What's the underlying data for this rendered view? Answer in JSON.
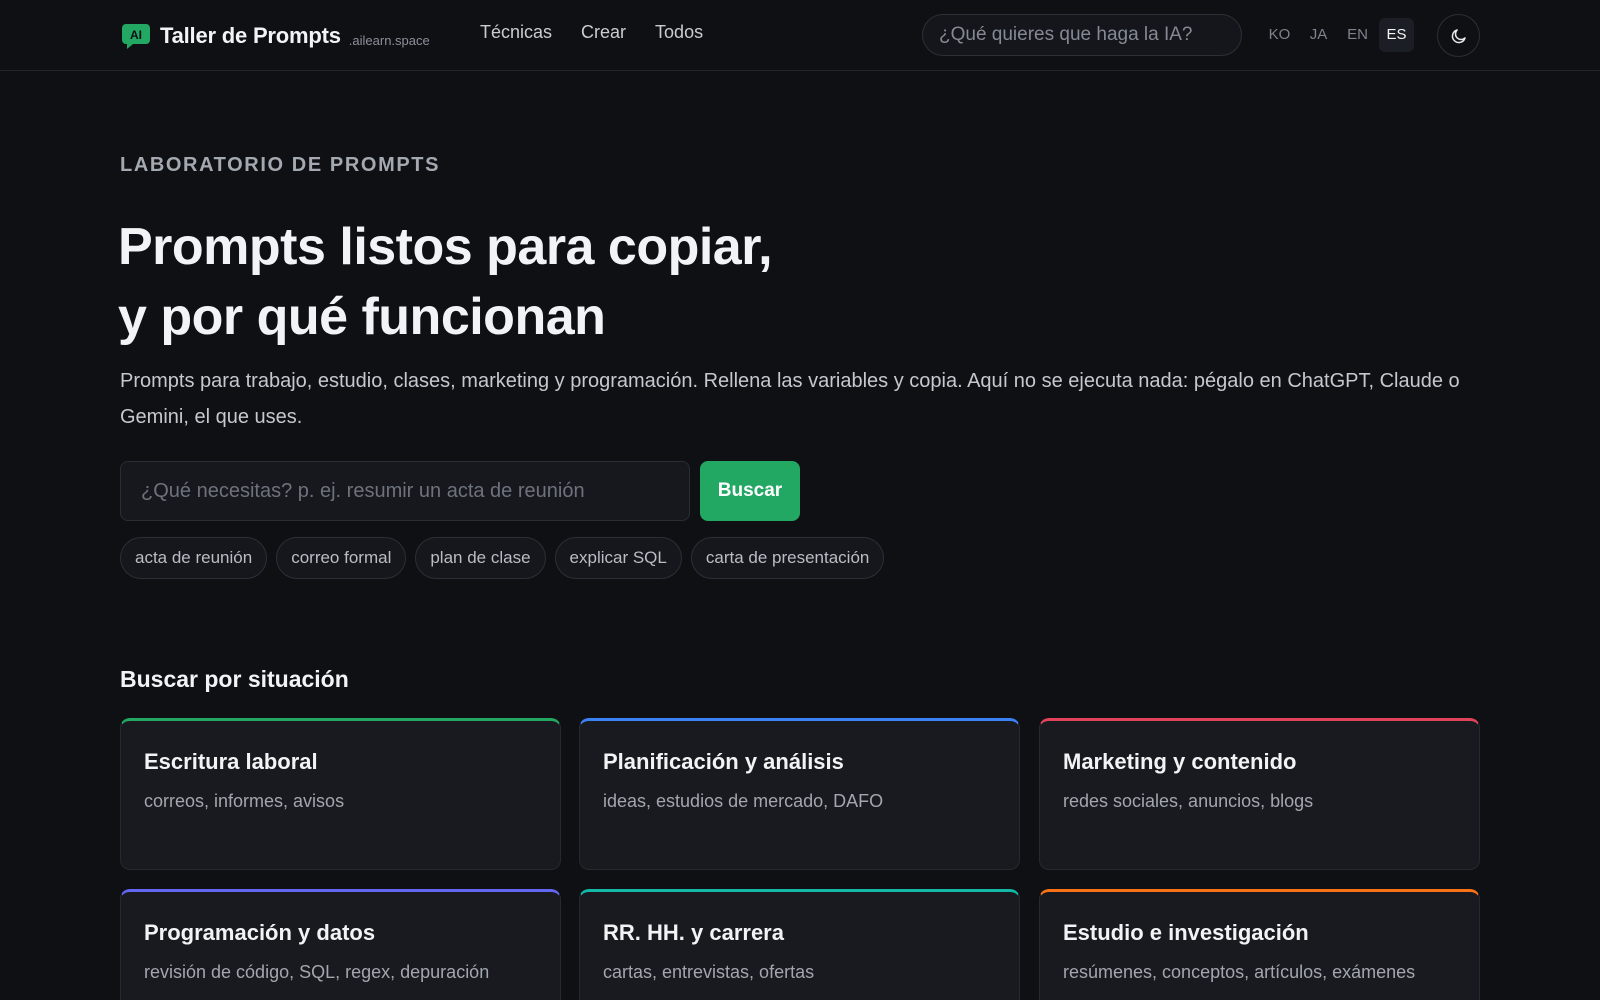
{
  "header": {
    "brand_name": "Taller de Prompts",
    "brand_domain": ".ailearn.space",
    "logo_text": "AI",
    "nav": [
      "Técnicas",
      "Crear",
      "Todos"
    ],
    "search_placeholder": "¿Qué quieres que haga la IA?",
    "languages": [
      "KO",
      "JA",
      "EN",
      "ES"
    ],
    "active_language": "ES",
    "theme_icon": "moon-icon"
  },
  "hero": {
    "eyebrow": "LABORATORIO DE PROMPTS",
    "title_line1": "Prompts listos para copiar,",
    "title_line2": "y por qué funcionan",
    "subtitle": "Prompts para trabajo, estudio, clases, marketing y programación. Rellena las variables y copia. Aquí no se ejecuta nada: pégalo en ChatGPT, Claude o Gemini, el que uses.",
    "search_placeholder": "¿Qué necesitas? p. ej. resumir un acta de reunión",
    "search_button": "Buscar",
    "chips": [
      "acta de reunión",
      "correo formal",
      "plan de clase",
      "explicar SQL",
      "carta de presentación"
    ]
  },
  "situations": {
    "title": "Buscar por situación",
    "cards": [
      {
        "title": "Escritura laboral",
        "desc": "correos, informes, avisos",
        "accent": "#22a863"
      },
      {
        "title": "Planificación y análisis",
        "desc": "ideas, estudios de mercado, DAFO",
        "accent": "#3b82f6"
      },
      {
        "title": "Marketing y contenido",
        "desc": "redes sociales, anuncios, blogs",
        "accent": "#e0435a"
      },
      {
        "title": "Programación y datos",
        "desc": "revisión de código, SQL, regex, depuración",
        "accent": "#6366f1"
      },
      {
        "title": "RR. HH. y carrera",
        "desc": "cartas, entrevistas, ofertas",
        "accent": "#14b8a6"
      },
      {
        "title": "Estudio e investigación",
        "desc": "resúmenes, conceptos, artículos, exámenes",
        "accent": "#f97316"
      }
    ]
  },
  "colors": {
    "background": "#0e1014",
    "primary": "#22a863"
  }
}
